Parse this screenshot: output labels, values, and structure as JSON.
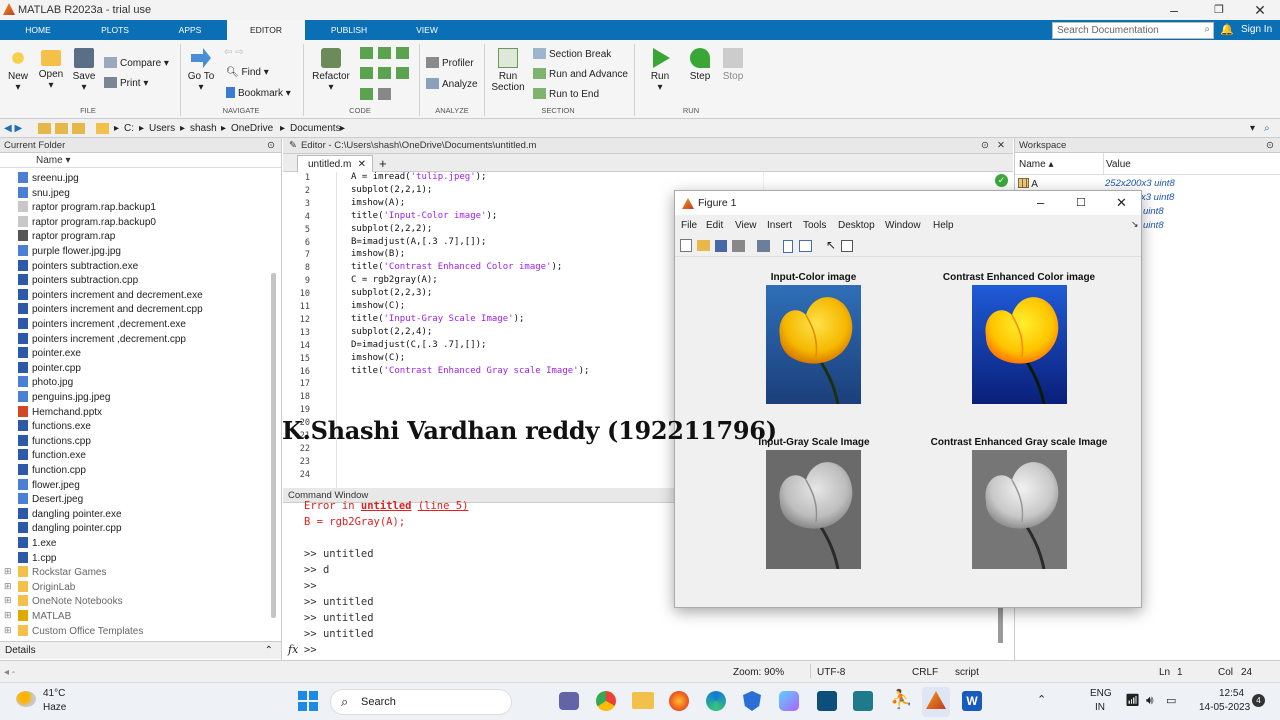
{
  "app": {
    "title": "MATLAB R2023a - trial use"
  },
  "tabs": [
    "HOME",
    "PLOTS",
    "APPS",
    "EDITOR",
    "PUBLISH",
    "VIEW"
  ],
  "search": {
    "placeholder": "Search Documentation"
  },
  "signin": "Sign In",
  "ribbon": {
    "new": "New",
    "open": "Open",
    "save": "Save",
    "compare": "Compare",
    "print": "Print",
    "goto_1": "Go To",
    "find": "Find",
    "bookmark": "Bookmark",
    "refactor": "Refactor",
    "profiler": "Profiler",
    "analyze": "Analyze",
    "run_section_1": "Run",
    "run_section_2": "Section",
    "section_break": "Section Break",
    "run_advance": "Run and Advance",
    "run_end": "Run to End",
    "run": "Run",
    "step": "Step",
    "stop": "Stop",
    "groups": {
      "file": "FILE",
      "navigate": "NAVIGATE",
      "code": "CODE",
      "analyze": "ANALYZE",
      "section": "SECTION",
      "run": "RUN"
    }
  },
  "path": [
    "C:",
    "Users",
    "shash",
    "OneDrive",
    "Documents"
  ],
  "current_folder": {
    "title": "Current Folder",
    "column": "Name",
    "files": [
      {
        "name": "sreenu.jpg",
        "kind": "img"
      },
      {
        "name": "snu.jpeg",
        "kind": "img"
      },
      {
        "name": "raptor program.rap.backup1",
        "kind": "doc"
      },
      {
        "name": "raptor program.rap.backup0",
        "kind": "doc"
      },
      {
        "name": "raptor program.rap",
        "kind": "rap"
      },
      {
        "name": "purple flower.jpg.jpg",
        "kind": "img"
      },
      {
        "name": "pointers subtraction.exe",
        "kind": "exe"
      },
      {
        "name": "pointers subtraction.cpp",
        "kind": "cpp"
      },
      {
        "name": "pointers increment and decrement.exe",
        "kind": "exe"
      },
      {
        "name": "pointers increment and decrement.cpp",
        "kind": "cpp"
      },
      {
        "name": "pointers increment ,decrement.exe",
        "kind": "exe"
      },
      {
        "name": "pointers increment ,decrement.cpp",
        "kind": "cpp"
      },
      {
        "name": "pointer.exe",
        "kind": "exe"
      },
      {
        "name": "pointer.cpp",
        "kind": "cpp"
      },
      {
        "name": "photo.jpg",
        "kind": "img"
      },
      {
        "name": "penguins.jpg.jpeg",
        "kind": "img"
      },
      {
        "name": "Hemchand.pptx",
        "kind": "ppt"
      },
      {
        "name": "functions.exe",
        "kind": "exe"
      },
      {
        "name": "functions.cpp",
        "kind": "cpp"
      },
      {
        "name": "function.exe",
        "kind": "exe"
      },
      {
        "name": "function.cpp",
        "kind": "cpp"
      },
      {
        "name": "flower.jpeg",
        "kind": "img"
      },
      {
        "name": "Desert.jpeg",
        "kind": "img"
      },
      {
        "name": "dangling pointer.exe",
        "kind": "exe"
      },
      {
        "name": "dangling pointer.cpp",
        "kind": "cpp"
      },
      {
        "name": "1.exe",
        "kind": "exe"
      },
      {
        "name": "1.cpp",
        "kind": "cpp"
      },
      {
        "name": "Rockstar Games",
        "kind": "folder"
      },
      {
        "name": "OriginLab",
        "kind": "folder"
      },
      {
        "name": "OneNote Notebooks",
        "kind": "folder"
      },
      {
        "name": "MATLAB",
        "kind": "folder-dark"
      },
      {
        "name": "Custom Office Templates",
        "kind": "folder"
      }
    ],
    "details": "Details"
  },
  "editor": {
    "title": "Editor - C:\\Users\\shash\\OneDrive\\Documents\\untitled.m",
    "tab": "untitled.m",
    "line_numbers": [
      "1",
      "2",
      "3",
      "4",
      "5",
      "6",
      "7",
      "8",
      "9",
      "10",
      "11",
      "12",
      "13",
      "14",
      "15",
      "16",
      "17",
      "18",
      "19",
      "20",
      "21",
      "22",
      "23",
      "24"
    ],
    "lines": [
      {
        "code": "A = imread(",
        "str": "'tulip.jpeg'",
        "tail": ");"
      },
      {
        "code": "subplot(2,2,1);",
        "str": "",
        "tail": ""
      },
      {
        "code": "imshow(A);",
        "str": "",
        "tail": ""
      },
      {
        "code": "title(",
        "str": "'Input-Color image'",
        "tail": ");"
      },
      {
        "code": "subplot(2,2,2);",
        "str": "",
        "tail": ""
      },
      {
        "code": "B=imadjust(A,[.3 .7],[]);",
        "str": "",
        "tail": ""
      },
      {
        "code": "imshow(B);",
        "str": "",
        "tail": ""
      },
      {
        "code": "title(",
        "str": "'Contrast Enhanced Color image'",
        "tail": ");"
      },
      {
        "code": "C = rgb2gray(A);",
        "str": "",
        "tail": ""
      },
      {
        "code": "subplot(2,2,3);",
        "str": "",
        "tail": ""
      },
      {
        "code": "imshow(C);",
        "str": "",
        "tail": ""
      },
      {
        "code": "title(",
        "str": "'Input-Gray Scale Image'",
        "tail": ");"
      },
      {
        "code": "subplot(2,2,4);",
        "str": "",
        "tail": ""
      },
      {
        "code": "D=imadjust(C,[.3 .7],[]);",
        "str": "",
        "tail": ""
      },
      {
        "code": "imshow(C);",
        "str": "",
        "tail": ""
      },
      {
        "code": "title(",
        "str": "'Contrast Enhanced Gray scale Image'",
        "tail": ");"
      }
    ]
  },
  "overlay_text": "K.Shashi Vardhan reddy (192211796)",
  "command_window": {
    "title": "Command Window",
    "err_prefix": "Error in ",
    "err_link": "untitled",
    "err_line": "(line 5)",
    "err_code": "B = rgb2Gray(A);",
    "history": [
      ">> untitled",
      ">> d",
      ">>",
      ">> untitled",
      ">> untitled",
      ">> untitled"
    ],
    "fx": "fx",
    "prompt": ">>"
  },
  "workspace": {
    "title": "Workspace",
    "col_name": "Name",
    "col_value": "Value",
    "var": "A",
    "values": [
      "252x200x3 uint8",
      "x3 uint8",
      "uint8",
      "uint8"
    ]
  },
  "figure": {
    "title": "Figure 1",
    "menu": [
      "File",
      "Edit",
      "View",
      "Insert",
      "Tools",
      "Desktop",
      "Window",
      "Help"
    ],
    "plots": [
      "Input-Color image",
      "Contrast Enhanced Color image",
      "Input-Gray Scale Image",
      "Contrast Enhanced Gray scale Image"
    ]
  },
  "status": {
    "zoom": "Zoom: 90%",
    "encoding": "UTF-8",
    "eol": "CRLF",
    "type": "script",
    "ln_label": "Ln",
    "ln": "1",
    "col_label": "Col",
    "col": "24"
  },
  "taskbar": {
    "weather_temp": "41°C",
    "weather_desc": "Haze",
    "search": "Search",
    "lang1": "ENG",
    "lang2": "IN",
    "time": "12:54",
    "date": "14-05-2023",
    "badge": "4"
  },
  "colors": {
    "accent": "#0a6fb5",
    "string": "#a020f0",
    "error": "#e02020"
  }
}
